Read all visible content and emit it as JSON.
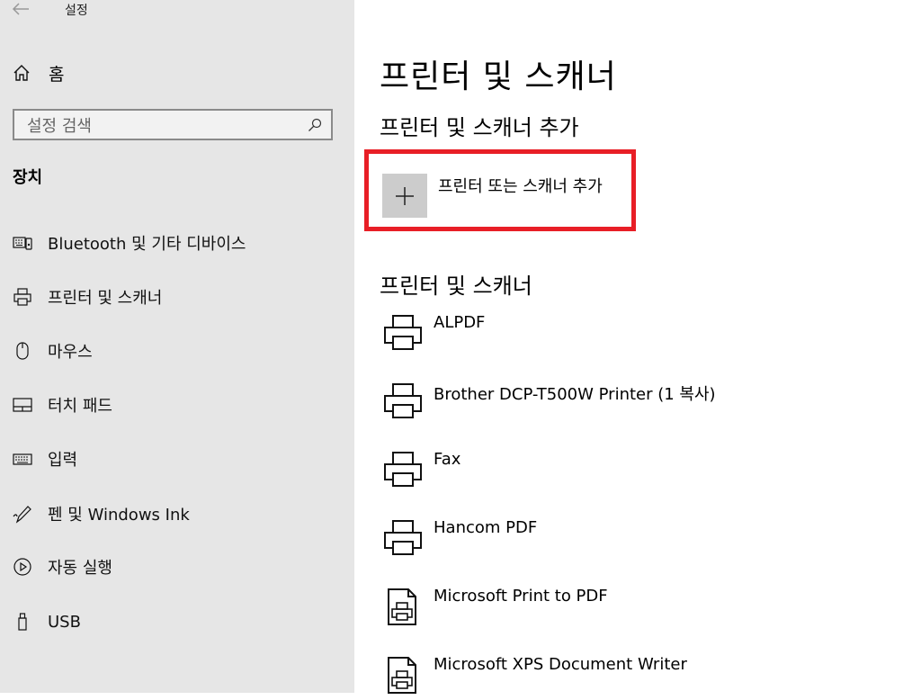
{
  "window": {
    "title": "설정"
  },
  "sidebar": {
    "home_label": "홈",
    "search_placeholder": "설정 검색",
    "section_title": "장치",
    "items": [
      {
        "label": "Bluetooth 및 기타 디바이스",
        "icon": "bluetooth-devices-icon"
      },
      {
        "label": "프린터 및 스캐너",
        "icon": "printer-icon"
      },
      {
        "label": "마우스",
        "icon": "mouse-icon"
      },
      {
        "label": "터치 패드",
        "icon": "touchpad-icon"
      },
      {
        "label": "입력",
        "icon": "keyboard-icon"
      },
      {
        "label": "펜 및 Windows Ink",
        "icon": "pen-icon"
      },
      {
        "label": "자동 실행",
        "icon": "autoplay-icon"
      },
      {
        "label": "USB",
        "icon": "usb-icon"
      }
    ]
  },
  "main": {
    "title": "프린터 및 스캐너",
    "add_heading": "프린터 및 스캐너 추가",
    "add_button_label": "프린터 또는 스캐너 추가",
    "list_heading": "프린터 및 스캐너",
    "printers": [
      {
        "name": "ALPDF",
        "icon": "printer-icon"
      },
      {
        "name": "Brother DCP-T500W Printer (1 복사)",
        "icon": "printer-icon"
      },
      {
        "name": "Fax",
        "icon": "printer-icon"
      },
      {
        "name": "Hancom PDF",
        "icon": "printer-icon"
      },
      {
        "name": "Microsoft Print to PDF",
        "icon": "document-printer-icon"
      },
      {
        "name": "Microsoft XPS Document Writer",
        "icon": "document-printer-icon"
      }
    ]
  },
  "colors": {
    "sidebar_bg": "#e6e6e6",
    "highlight_border": "#e81e26",
    "add_button_bg": "#cccccc"
  }
}
